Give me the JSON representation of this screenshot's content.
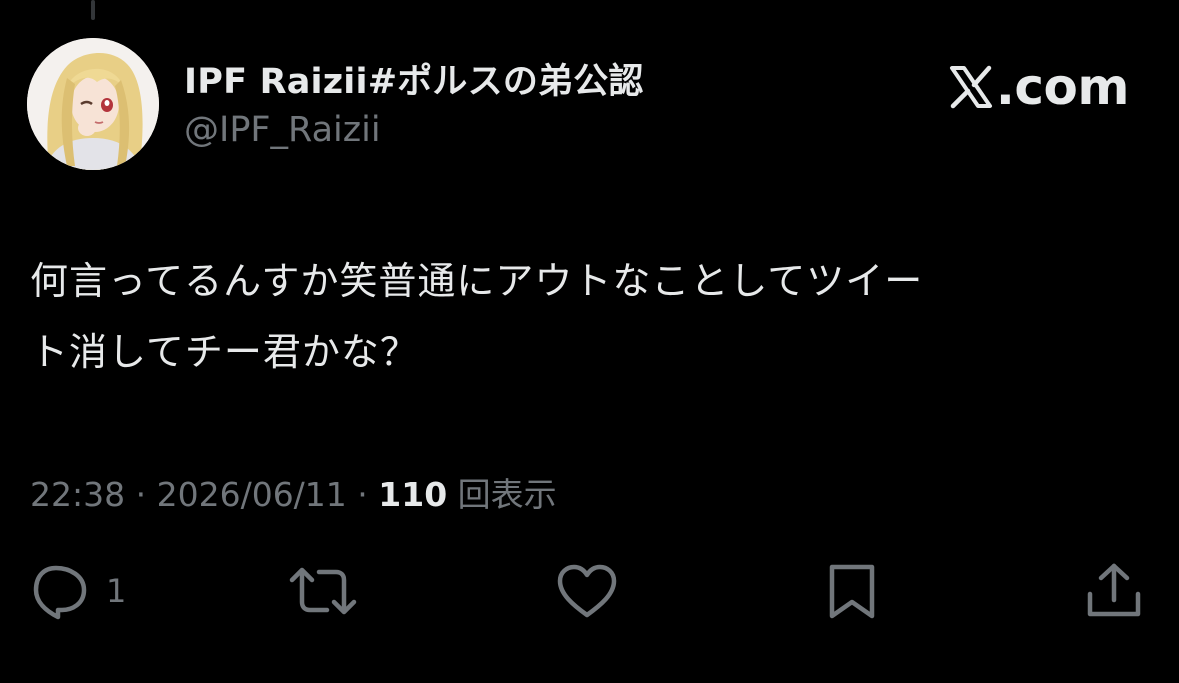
{
  "author": {
    "display_name": "IPF Raizii#ポルスの弟公認",
    "handle": "@IPF_Raizii",
    "avatar_icon": "anime-girl-avatar"
  },
  "brand": {
    "label": ".com",
    "icon": "x-logo-icon"
  },
  "tweet": {
    "text_line1": "何言ってるんすか笑普通にアウトなことしてツイー",
    "text_line2": "ト消してチー君かな？",
    "time": "22:38",
    "separator1": " · ",
    "date": "2026/06/11",
    "separator2": " · ",
    "views_count": "110",
    "views_label": " 回表示"
  },
  "actions": {
    "reply_count": "1",
    "icons": [
      "reply-icon",
      "retweet-icon",
      "like-icon",
      "bookmark-icon",
      "share-icon"
    ]
  },
  "colors": {
    "background": "#000000",
    "text_primary": "#e7e9ea",
    "text_secondary": "#71767b"
  }
}
